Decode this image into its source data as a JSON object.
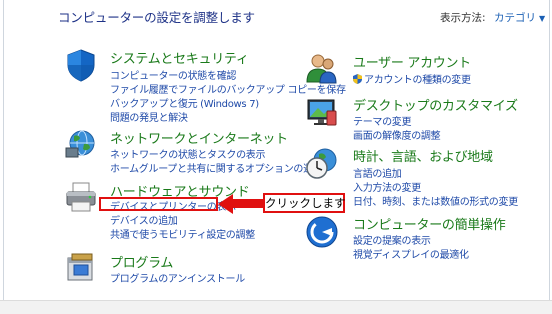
{
  "header": {
    "title": "コンピューターの設定を調整します",
    "view_label": "表示方法:",
    "view_value": "カテゴリ"
  },
  "categories": {
    "system": {
      "title": "システムとセキュリティ",
      "icon": "shield-icon",
      "links": [
        "コンピューターの状態を確認",
        "ファイル履歴でファイルのバックアップ コピーを保存",
        "バックアップと復元 (Windows 7)",
        "問題の発見と解決"
      ]
    },
    "network": {
      "title": "ネットワークとインターネット",
      "icon": "network-globe-icon",
      "links": [
        "ネットワークの状態とタスクの表示",
        "ホームグループと共有に関するオプションの選択"
      ]
    },
    "hardware": {
      "title": "ハードウェアとサウンド",
      "icon": "printer-icon",
      "links": [
        "デバイスとプリンターの表示",
        "デバイスの追加",
        "共通で使うモビリティ設定の調整"
      ]
    },
    "programs": {
      "title": "プログラム",
      "icon": "programs-icon",
      "links": [
        "プログラムのアンインストール"
      ]
    },
    "user_accounts": {
      "title": "ユーザー アカウント",
      "icon": "users-icon",
      "links": [
        "アカウントの種類の変更"
      ]
    },
    "appearance": {
      "title": "デスクトップのカスタマイズ",
      "icon": "desktop-icon",
      "links": [
        "テーマの変更",
        "画面の解像度の調整"
      ]
    },
    "clock": {
      "title": "時計、言語、および地域",
      "icon": "clock-globe-icon",
      "links": [
        "言語の追加",
        "入力方法の変更",
        "日付、時刻、または数値の形式の変更"
      ]
    },
    "ease": {
      "title": "コンピューターの簡単操作",
      "icon": "ease-of-access-icon",
      "links": [
        "設定の提案の表示",
        "視覚ディスプレイの最適化"
      ]
    }
  },
  "annotation": {
    "callout": "クリックします",
    "color": "#e01010"
  }
}
